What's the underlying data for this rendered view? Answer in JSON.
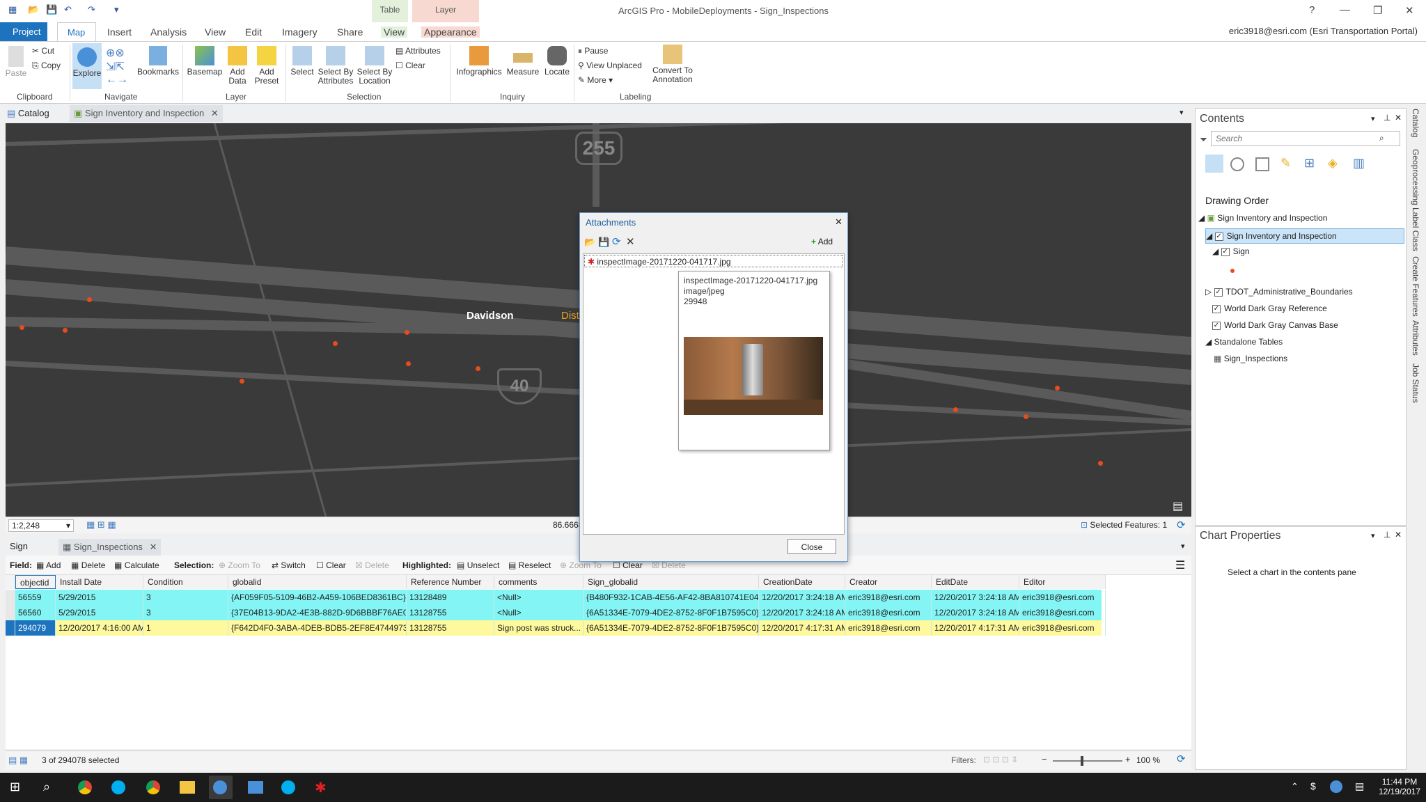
{
  "title_bar": {
    "app_title": "ArcGIS Pro - MobileDeployments - Sign_Inspections",
    "context_table": "Table",
    "context_layer": "Layer",
    "help": "?"
  },
  "ribbon_tabs": [
    "Project",
    "Map",
    "Insert",
    "Analysis",
    "View",
    "Edit",
    "Imagery",
    "Share",
    "View",
    "Appearance"
  ],
  "user": "eric3918@esri.com (Esri Transportation Portal)",
  "ribbon": {
    "clipboard": {
      "paste": "Paste",
      "cut": "Cut",
      "copy": "Copy",
      "group": "Clipboard"
    },
    "navigate": {
      "explore": "Explore",
      "bookmarks": "Bookmarks",
      "group": "Navigate"
    },
    "layer": {
      "basemap": "Basemap",
      "add_data": "Add Data",
      "add_preset": "Add Preset",
      "group": "Layer"
    },
    "selection": {
      "select": "Select",
      "by_attr": "Select By Attributes",
      "by_loc": "Select By Location",
      "attributes": "Attributes",
      "clear": "Clear",
      "group": "Selection"
    },
    "inquiry": {
      "infographics": "Infographics",
      "measure": "Measure",
      "locate": "Locate",
      "group": "Inquiry"
    },
    "labeling": {
      "pause": "Pause",
      "view_unplaced": "View Unplaced",
      "more": "More",
      "convert": "Convert To Annotation",
      "group": "Labeling"
    }
  },
  "doc_tabs": {
    "catalog": "Catalog",
    "map_tab": "Sign Inventory and Inspection"
  },
  "map": {
    "label_davidson": "Davidson",
    "label_dist": "Dist",
    "shield_255": "255",
    "shield_40": "40",
    "scale": "1:2,248",
    "coord": "86.6668",
    "selected_features": "Selected Features: 1"
  },
  "attachments_dialog": {
    "title": "Attachments",
    "add": "Add",
    "file": "inspectImage-20171220-041717.jpg",
    "tooltip_name": "inspectImage-20171220-041717.jpg",
    "tooltip_type": "image/jpeg",
    "tooltip_size": "29948",
    "close": "Close"
  },
  "table_tabs": {
    "sign": "Sign",
    "inspections": "Sign_Inspections"
  },
  "table_toolbar": {
    "field": "Field:",
    "add": "Add",
    "delete": "Delete",
    "calculate": "Calculate",
    "selection": "Selection:",
    "zoom_to": "Zoom To",
    "switch": "Switch",
    "clear": "Clear",
    "delete2": "Delete",
    "highlighted": "Highlighted:",
    "unselect": "Unselect",
    "reselect": "Reselect",
    "zoom_to2": "Zoom To",
    "clear2": "Clear",
    "delete3": "Delete"
  },
  "table": {
    "columns": [
      "objectid",
      "Install Date",
      "Condition",
      "globalid",
      "Reference Number",
      "comments",
      "Sign_globalid",
      "CreationDate",
      "Creator",
      "EditDate",
      "Editor"
    ],
    "rows": [
      [
        "56559",
        "5/29/2015",
        "3",
        "{AF059F05-5109-46B2-A459-106BED8361BC}",
        "13128489",
        "<Null>",
        "{B480F932-1CAB-4E56-AF42-8BA810741E04}",
        "12/20/2017 3:24:18 AM",
        "eric3918@esri.com",
        "12/20/2017 3:24:18 AM",
        "eric3918@esri.com"
      ],
      [
        "56560",
        "5/29/2015",
        "3",
        "{37E04B13-9DA2-4E3B-882D-9D6BBBF76AE0}",
        "13128755",
        "<Null>",
        "{6A51334E-7079-4DE2-8752-8F0F1B7595C0}",
        "12/20/2017 3:24:18 AM",
        "eric3918@esri.com",
        "12/20/2017 3:24:18 AM",
        "eric3918@esri.com"
      ],
      [
        "294079",
        "12/20/2017 4:16:00 AM",
        "1",
        "{F642D4F0-3ABA-4DEB-BDB5-2EF8E4744973}",
        "13128755",
        "Sign post was struck...",
        "{6A51334E-7079-4DE2-8752-8F0F1B7595C0}",
        "12/20/2017 4:17:31 AM",
        "eric3918@esri.com",
        "12/20/2017 4:17:31 AM",
        "eric3918@esri.com"
      ]
    ],
    "status": "3 of 294078 selected",
    "filters": "Filters:",
    "zoom": "100 %"
  },
  "contents": {
    "title": "Contents",
    "search_placeholder": "Search",
    "drawing_order": "Drawing Order",
    "items": [
      "Sign Inventory and Inspection",
      "Sign Inventory and Inspection",
      "Sign",
      "TDOT_Administrative_Boundaries",
      "World Dark Gray Reference",
      "World Dark Gray Canvas Base",
      "Standalone Tables",
      "Sign_Inspections"
    ]
  },
  "chart_properties": {
    "title": "Chart Properties",
    "message": "Select a chart in the contents pane"
  },
  "side_tabs": [
    "Catalog",
    "Geoprocessing",
    "Label Class",
    "Create Features",
    "Attributes",
    "Job Status"
  ],
  "taskbar": {
    "time": "11:44 PM",
    "date": "12/19/2017"
  },
  "colors": {
    "accent": "#1e73be",
    "selected_row": "#84f5f5",
    "highlight_row": "#fdf99c",
    "feature_point": "#e84c1c"
  }
}
